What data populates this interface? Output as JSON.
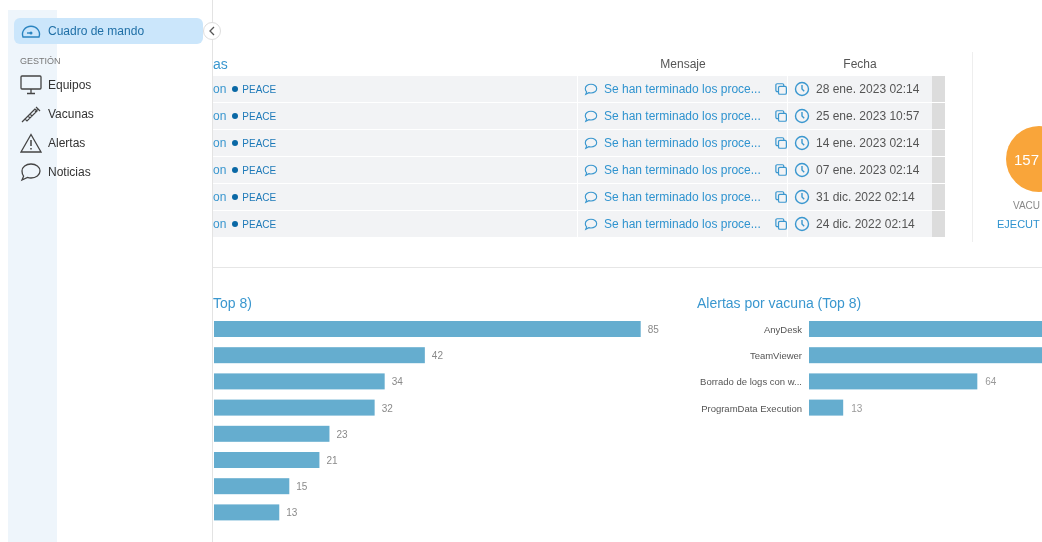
{
  "sidebar": {
    "items": [
      {
        "label": "Cuadro de mando",
        "selected": true
      }
    ],
    "section": "GESTIÓN",
    "section_items": [
      {
        "label": "Equipos",
        "selected": false
      },
      {
        "label": "Vacunas",
        "selected": false
      },
      {
        "label": "Alertas",
        "selected": false
      },
      {
        "label": "Noticias",
        "selected": false
      }
    ]
  },
  "alerts": {
    "title": "as",
    "columns": [
      "Mensaje",
      "Fecha"
    ],
    "rows": [
      {
        "name": "on",
        "tag": "PEACE",
        "message": "Se han terminado los proce...",
        "date": "28 ene. 2023 02:14"
      },
      {
        "name": "on",
        "tag": "PEACE",
        "message": "Se han terminado los proce...",
        "date": "25 ene. 2023 10:57"
      },
      {
        "name": "on",
        "tag": "PEACE",
        "message": "Se han terminado los proce...",
        "date": "14 ene. 2023 02:14"
      },
      {
        "name": "on",
        "tag": "PEACE",
        "message": "Se han terminado los proce...",
        "date": "07 ene. 2023 02:14"
      },
      {
        "name": "on",
        "tag": "PEACE",
        "message": "Se han terminado los proce...",
        "date": "31 dic. 2022 02:14"
      },
      {
        "name": "on",
        "tag": "PEACE",
        "message": "Se han terminado los proce...",
        "date": "24 dic. 2022 02:14"
      }
    ]
  },
  "summary": {
    "count": "157",
    "label": "VACU",
    "status": "EJECUT"
  },
  "charts": [
    {
      "chart_data": {
        "type": "bar",
        "orientation": "horizontal",
        "title": "Top 8)",
        "series": [
          {
            "color": "#65adcf",
            "values": [
              85,
              42,
              34,
              32,
              23,
              21,
              15,
              13
            ]
          }
        ],
        "data_labels": true
      }
    },
    {
      "chart_data": {
        "type": "bar",
        "orientation": "horizontal",
        "title": "Alertas por vacuna (Top 8)",
        "categories": [
          "AnyDesk",
          "TeamViewer",
          "Borrado de logs con w...",
          "ProgramData Execution"
        ],
        "series": [
          {
            "color": "#65adcf",
            "values": [
              null,
              null,
              64,
              13
            ]
          }
        ],
        "data_labels": true
      }
    }
  ]
}
